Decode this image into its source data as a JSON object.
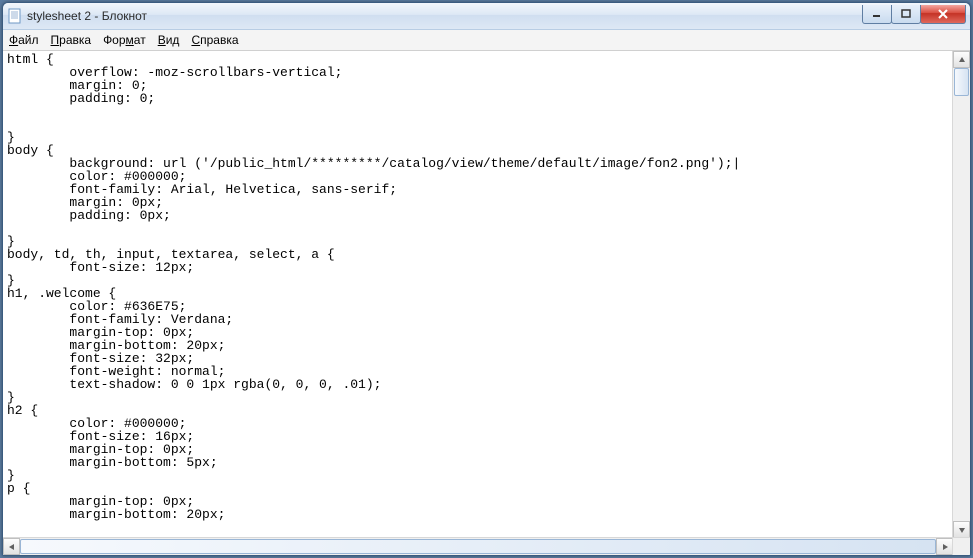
{
  "window": {
    "title": "stylesheet 2 - Блокнот"
  },
  "menu": {
    "file": {
      "pre": "",
      "ul": "Ф",
      "post": "айл"
    },
    "edit": {
      "pre": "",
      "ul": "П",
      "post": "равка"
    },
    "format": {
      "pre": "Фор",
      "ul": "м",
      "post": "ат"
    },
    "view": {
      "pre": "",
      "ul": "В",
      "post": "ид"
    },
    "help": {
      "pre": "",
      "ul": "С",
      "post": "правка"
    }
  },
  "editor": {
    "lines": [
      "html {",
      "        overflow: -moz-scrollbars-vertical;",
      "        margin: 0;",
      "        padding: 0;",
      "",
      "",
      "}",
      "body {",
      "        background: url ('/public_html/*********/catalog/view/theme/default/image/fon2.png');|",
      "        color: #000000;",
      "        font-family: Arial, Helvetica, sans-serif;",
      "        margin: 0px;",
      "        padding: 0px;",
      "",
      "}",
      "body, td, th, input, textarea, select, a {",
      "        font-size: 12px;",
      "}",
      "h1, .welcome {",
      "        color: #636E75;",
      "        font-family: Verdana;",
      "        margin-top: 0px;",
      "        margin-bottom: 20px;",
      "        font-size: 32px;",
      "        font-weight: normal;",
      "        text-shadow: 0 0 1px rgba(0, 0, 0, .01);",
      "}",
      "h2 {",
      "        color: #000000;",
      "        font-size: 16px;",
      "        margin-top: 0px;",
      "        margin-bottom: 5px;",
      "}",
      "p {",
      "        margin-top: 0px;",
      "        margin-bottom: 20px;"
    ]
  }
}
